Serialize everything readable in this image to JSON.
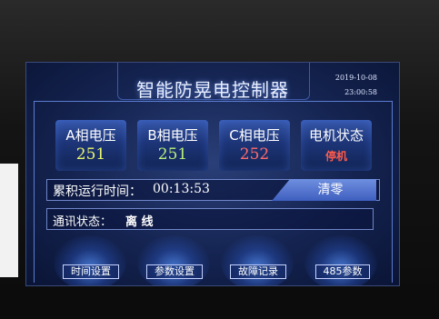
{
  "header": {
    "title": "智能防晃电控制器",
    "date": "2019-10-08",
    "time": "23:00:58"
  },
  "phases": [
    {
      "label": "A相电压",
      "value": "251",
      "color": "#e8f56a"
    },
    {
      "label": "B相电压",
      "value": "251",
      "color": "#b8f07a"
    },
    {
      "label": "C相电压",
      "value": "252",
      "color": "#ff6a6a"
    }
  ],
  "motor": {
    "label": "电机状态",
    "status": "停机",
    "status_color": "#ff5a4a"
  },
  "runtime": {
    "label": "累积运行时间：",
    "value": "00:13:53",
    "clear_label": "清零"
  },
  "comm": {
    "label": "通讯状态：",
    "value": "离 线"
  },
  "footer": {
    "buttons": [
      "时间设置",
      "参数设置",
      "故障记录",
      "485参数"
    ]
  }
}
